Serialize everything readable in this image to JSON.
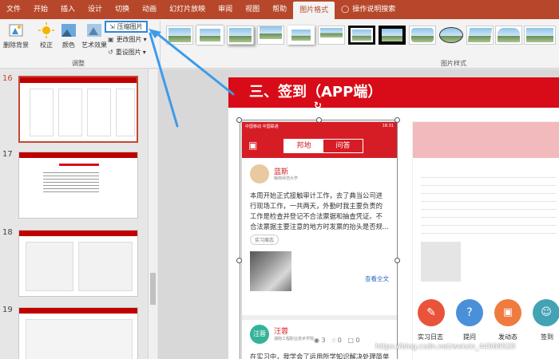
{
  "tabs": [
    "文件",
    "开始",
    "插入",
    "设计",
    "切换",
    "动画",
    "幻灯片放映",
    "审阅",
    "视图",
    "帮助",
    "图片格式",
    "操作说明搜索"
  ],
  "active_tab_index": 10,
  "ribbon": {
    "remove_bg": "删除背景",
    "correct": "校正",
    "color": "颜色",
    "art_effects": "艺术效果",
    "compress": "压缩图片",
    "change": "更改图片",
    "reset": "重设图片",
    "group_adjust": "调整",
    "group_styles": "图片样式"
  },
  "slides": [
    {
      "num": "16",
      "title": "三、签到（APP端）"
    },
    {
      "num": "17",
      "title": "记录实习日/周/月志"
    },
    {
      "num": "18",
      "title": "三、签到（PC端）"
    },
    {
      "num": "19",
      "title": ""
    }
  ],
  "slide": {
    "title": "三、签到（APP端）",
    "phone": {
      "status_left": "中国移动 中国联通",
      "status_right": "18:31",
      "seg_a": "邦地",
      "seg_b": "问答",
      "post1": {
        "name": "蓝斯",
        "school": "赣南师范大学",
        "text": "本周开始正式接触审计工作，去了典当公司进行现场工作，一共两天，外勤时我主要负责的工作是检查并登记不合法票据和抽查凭证。不合法票据主要注意的地方时发票的抬头是否规...",
        "tag": "实习周志",
        "more": "查看全文",
        "views": "3",
        "likes": "0",
        "comments": "0"
      },
      "post2": {
        "avatar_text": "汪蓉",
        "name": "汪蓉",
        "school": "湖南工程职业技术学院",
        "text": "在实习中，我学会了运用所学知识解决处理简单问题的方法与技巧，学会了与员工同事相处..."
      }
    },
    "fabs": [
      "实习日志",
      "提问",
      "发动态",
      "签到"
    ]
  },
  "watermark": "https://blog.csdn.net/weixin_44569520"
}
